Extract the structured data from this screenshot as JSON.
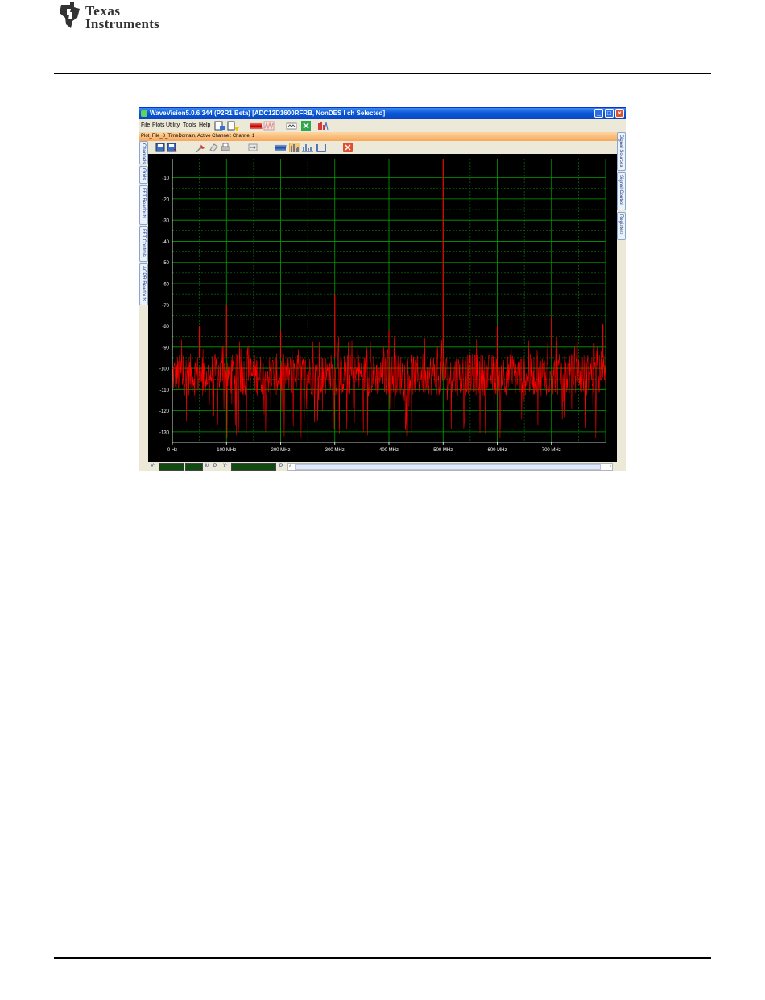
{
  "brand": {
    "line1": "Texas",
    "line2": "Instruments",
    "logo_icon": "ti-logo-icon"
  },
  "window": {
    "title": "WaveVision5.0.6.344 (P2R1 Beta)  [ADC12D1600RFRB, NonDES I ch Selected]",
    "controls": {
      "minimize": "_",
      "maximize": "□",
      "close": "×"
    }
  },
  "menu": {
    "items": [
      "File",
      "Plots",
      "Utility",
      "Tools",
      "Help"
    ]
  },
  "plot_info": "Plot_File_8_TimeDomain,  Active Channel: Channel 1",
  "left_tabs": [
    "Channels",
    "Grids",
    "FFT Readouts",
    "FFT Controls",
    "ACPR Readouts"
  ],
  "right_tabs": [
    "Signal Sources",
    "Signal Control",
    "Registers"
  ],
  "status": {
    "y_label": "Y:",
    "x_label": "X:",
    "m_label": "M",
    "p_label": "P",
    "p2_label": "P"
  },
  "colors": {
    "trace": "#ff0000",
    "grid": "#00a000",
    "background": "#000000",
    "titlebar": "#0a58d8",
    "plot_info_bar": "#f6a75a"
  },
  "chart_data": {
    "type": "line",
    "title": "",
    "xlabel": "",
    "ylabel": "",
    "x_ticks": [
      "0 Hz",
      "100 MHz",
      "200 MHz",
      "300 MHz",
      "400 MHz",
      "500 MHz",
      "600 MHz",
      "700 MHz"
    ],
    "y_ticks": [
      "-10",
      "-20",
      "-30",
      "-40",
      "-50",
      "-60",
      "-70",
      "-80",
      "-90",
      "-100",
      "-110",
      "-120",
      "-130"
    ],
    "xlim": [
      0,
      800
    ],
    "ylim": [
      -135,
      -1
    ],
    "x_unit": "MHz",
    "y_unit": "dB",
    "grid": true,
    "noise_floor": {
      "x": [
        0,
        800
      ],
      "y_range": [
        -113,
        -93
      ]
    },
    "spikes": [
      {
        "x": 500,
        "y": -1
      },
      {
        "x": 300,
        "y": -65
      },
      {
        "x": 100,
        "y": -70
      },
      {
        "x": 700,
        "y": -76
      },
      {
        "x": 50,
        "y": -80
      },
      {
        "x": 200,
        "y": -82
      },
      {
        "x": 400,
        "y": -82
      },
      {
        "x": 600,
        "y": -80
      },
      {
        "x": 795,
        "y": -79
      }
    ]
  }
}
